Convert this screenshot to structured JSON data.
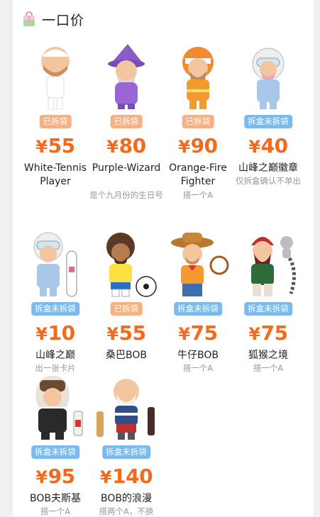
{
  "header": {
    "title": "一口价"
  },
  "items": [
    {
      "name": "White-Tennis Player",
      "badge": "已拆袋",
      "badge_type": "opened",
      "price_symbol": "¥",
      "price": "55",
      "note": ""
    },
    {
      "name": "Purple-Wizard",
      "badge": "已拆袋",
      "badge_type": "opened",
      "price_symbol": "¥",
      "price": "80",
      "note": "是个九月份的生日号"
    },
    {
      "name": "Orange-Fire Fighter",
      "badge": "已拆袋",
      "badge_type": "opened",
      "price_symbol": "¥",
      "price": "90",
      "note": "搭一个A"
    },
    {
      "name": "山峰之巅徽章",
      "badge": "拆盒未拆袋",
      "badge_type": "sealed",
      "price_symbol": "¥",
      "price": "40",
      "note": "仅拆盒确认不单出"
    },
    {
      "name": "山峰之巅",
      "badge": "拆盒未拆袋",
      "badge_type": "sealed",
      "price_symbol": "¥",
      "price": "10",
      "note": "出一张卡片"
    },
    {
      "name": "桑巴BOB",
      "badge": "已拆袋",
      "badge_type": "opened",
      "price_symbol": "¥",
      "price": "55",
      "note": ""
    },
    {
      "name": "牛仔BOB",
      "badge": "拆盒未拆袋",
      "badge_type": "sealed",
      "price_symbol": "¥",
      "price": "75",
      "note": "搭一个A"
    },
    {
      "name": "狐猴之境",
      "badge": "拆盒未拆袋",
      "badge_type": "sealed",
      "price_symbol": "¥",
      "price": "75",
      "note": "搭一个A"
    },
    {
      "name": "BOB夫斯基",
      "badge": "拆盒未拆袋",
      "badge_type": "sealed",
      "price_symbol": "¥",
      "price": "95",
      "note": "搭一个A"
    },
    {
      "name": "BOB的浪漫",
      "badge": "拆盒未拆袋",
      "badge_type": "sealed",
      "price_symbol": "¥",
      "price": "140",
      "note": "搭两个A，不换"
    }
  ],
  "colors": {
    "price": "#f26b1d",
    "badge_opened": "#f4b183",
    "badge_sealed": "#7cb9ec"
  },
  "icons": [
    "shopping-bag-icon"
  ]
}
